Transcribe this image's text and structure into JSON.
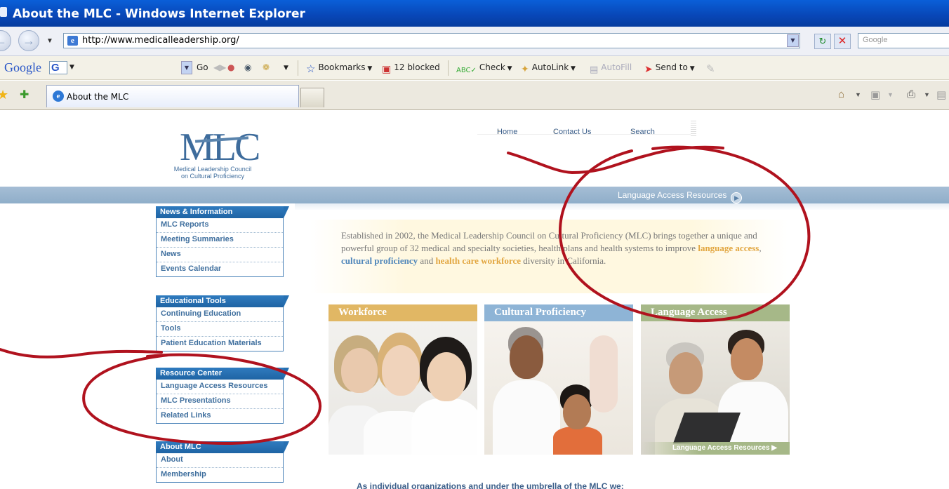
{
  "window": {
    "title": "About the MLC - Windows Internet Explorer"
  },
  "address": {
    "url": "http://www.medicalleadership.org/",
    "search_placeholder": "Google"
  },
  "google_toolbar": {
    "logo": "Google",
    "go": "Go",
    "bookmarks": "Bookmarks",
    "blocked": "12 blocked",
    "check": "Check",
    "autolink": "AutoLink",
    "autofill": "AutoFill",
    "sendto": "Send to"
  },
  "tabs": [
    {
      "label": "About the MLC"
    }
  ],
  "topnav": {
    "home": "Home",
    "contact": "Contact Us",
    "search": "Search"
  },
  "logo": {
    "text": "MLC",
    "line1": "Medical Leadership Council",
    "line2": "on Cultural Proficiency"
  },
  "banner_link": "Language Access Resources",
  "sidebar": [
    {
      "header": "News & Information",
      "items": [
        "MLC Reports",
        "Meeting Summaries",
        "News",
        "Events Calendar"
      ]
    },
    {
      "header": "Educational Tools",
      "items": [
        "Continuing Education",
        "Tools",
        "Patient Education Materials"
      ]
    },
    {
      "header": "Resource Center",
      "items": [
        "Language Access Resources",
        "MLC Presentations",
        "Related Links"
      ]
    },
    {
      "header": "About MLC",
      "items": [
        "About",
        "Membership"
      ]
    }
  ],
  "intro": {
    "part1": "Established in 2002, the Medical Leadership Council on Cultural Proficiency (MLC) brings together a unique and powerful group of 32 medical and specialty societies, health plans and health systems to improve ",
    "hl_language": "language access",
    "comma": ", ",
    "hl_cultural": "cultural proficiency",
    "and": " and ",
    "hl_workforce": "health care workforce",
    "part2": " diversity in California."
  },
  "cards": [
    {
      "caption": "Workforce"
    },
    {
      "caption": "Cultural Proficiency"
    },
    {
      "caption": "Language Access",
      "footer": "Language Access Resources"
    }
  ],
  "bottom_text": "As individual organizations and under the umbrella of the MLC we:",
  "colors": {
    "accent_blue": "#4f86ba",
    "accent_gold": "#e2a640",
    "annotation_red": "#b0121e"
  }
}
